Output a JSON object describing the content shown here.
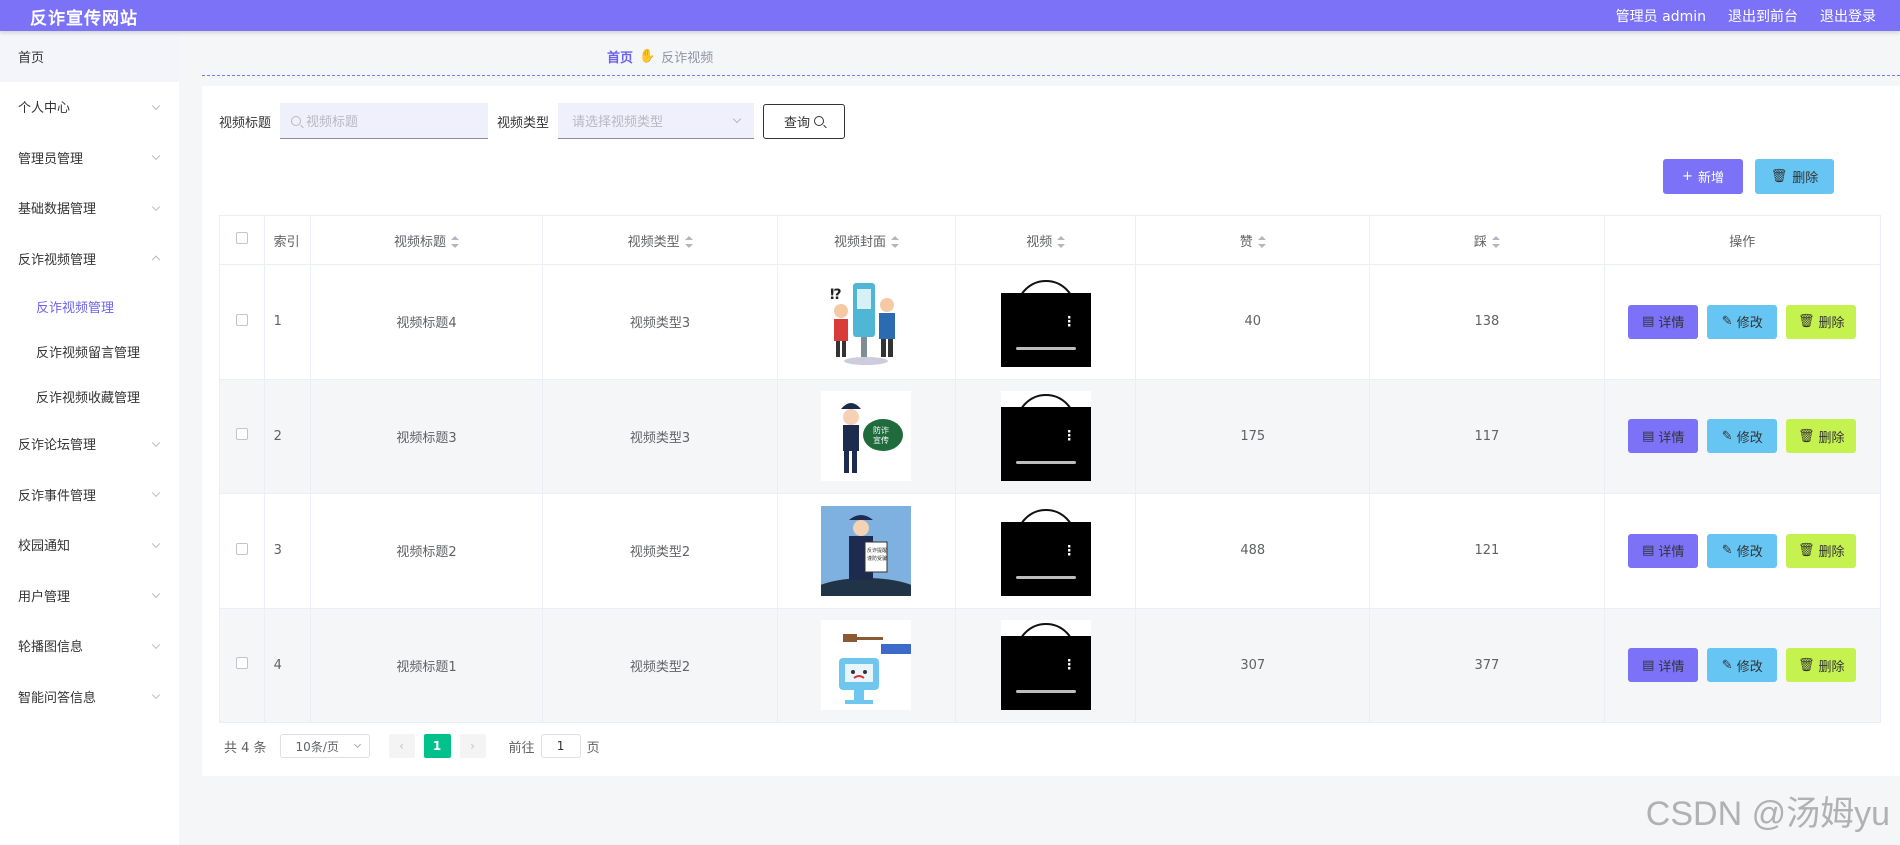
{
  "header": {
    "brand": "反诈宣传网站",
    "links": [
      "管理员 admin",
      "退出到前台",
      "退出登录"
    ]
  },
  "sidebar": {
    "home": "首页",
    "items_top": [
      {
        "label": "个人中心"
      },
      {
        "label": "管理员管理"
      },
      {
        "label": "基础数据管理"
      },
      {
        "label": "反诈视频管理"
      }
    ],
    "sub_items": [
      {
        "label": "反诈视频管理"
      },
      {
        "label": "反诈视频留言管理"
      },
      {
        "label": "反诈视频收藏管理"
      }
    ],
    "items_bottom": [
      {
        "label": "反诈论坛管理"
      },
      {
        "label": "反诈事件管理"
      },
      {
        "label": "校园通知"
      },
      {
        "label": "用户管理"
      },
      {
        "label": "轮播图信息"
      },
      {
        "label": "智能问答信息"
      }
    ]
  },
  "breadcrumb": {
    "home": "首页",
    "current": "反诈视频"
  },
  "search": {
    "title_label": "视频标题",
    "title_placeholder": "视频标题",
    "type_label": "视频类型",
    "type_placeholder": "请选择视频类型",
    "query_label": "查询"
  },
  "actions": {
    "add": "新增",
    "delete": "删除"
  },
  "table": {
    "columns": [
      "索引",
      "视频标题",
      "视频类型",
      "视频封面",
      "视频",
      "赞",
      "踩",
      "操作"
    ],
    "rows": [
      {
        "index": "1",
        "title": "视频标题4",
        "type": "视频类型3",
        "likes": "40",
        "dislikes": "138"
      },
      {
        "index": "2",
        "title": "视频标题3",
        "type": "视频类型3",
        "likes": "175",
        "dislikes": "117"
      },
      {
        "index": "3",
        "title": "视频标题2",
        "type": "视频类型2",
        "likes": "488",
        "dislikes": "121"
      },
      {
        "index": "4",
        "title": "视频标题1",
        "type": "视频类型2",
        "likes": "307",
        "dislikes": "377"
      }
    ],
    "row_ops": {
      "detail": "详情",
      "edit": "修改",
      "delete": "删除"
    }
  },
  "pagination": {
    "total": "共 4 条",
    "page_size": "10条/页",
    "current_page": "1",
    "goto_label": "前往",
    "goto_value": "1",
    "page_suffix": "页"
  },
  "watermark": "CSDN @汤姆yu",
  "colors": {
    "accent": "#7b72f8",
    "info": "#66c5f3",
    "lime": "#c5f24f",
    "page_active": "#00c18b"
  }
}
